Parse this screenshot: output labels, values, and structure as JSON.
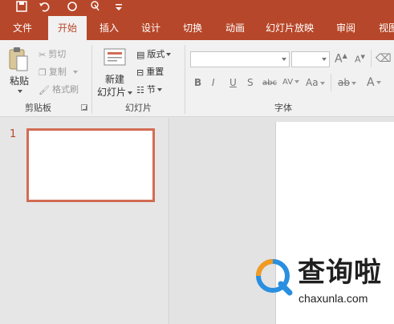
{
  "quick_access": {
    "icons": [
      "save-icon",
      "undo-icon",
      "redo-icon",
      "touch-mode-icon",
      "customize-icon"
    ]
  },
  "tabs": [
    {
      "label": "文件",
      "active": false
    },
    {
      "label": "开始",
      "active": true
    },
    {
      "label": "插入",
      "active": false
    },
    {
      "label": "设计",
      "active": false
    },
    {
      "label": "切换",
      "active": false
    },
    {
      "label": "动画",
      "active": false
    },
    {
      "label": "幻灯片放映",
      "active": false
    },
    {
      "label": "审阅",
      "active": false
    },
    {
      "label": "视图",
      "active": false
    }
  ],
  "ribbon": {
    "clipboard": {
      "paste": "粘贴",
      "cut": "剪切",
      "copy": "复制",
      "format_painter": "格式刷",
      "label": "剪贴板"
    },
    "slides": {
      "new_slide_line1": "新建",
      "new_slide_line2": "幻灯片",
      "layout": "版式",
      "reset": "重置",
      "section": "节",
      "label": "幻灯片"
    },
    "font": {
      "font_name": "",
      "font_size": "",
      "grow": "A",
      "shrink": "A",
      "bold": "B",
      "italic": "I",
      "underline": "U",
      "shadow": "S",
      "strikethrough": "abc",
      "spacing": "AV",
      "case": "Aa",
      "highlight": "ab",
      "color": "A",
      "label": "字体"
    }
  },
  "thumbnails": [
    {
      "number": "1",
      "selected": true
    }
  ],
  "watermark": {
    "brand": "查询啦",
    "domain": "chaxunla.com"
  },
  "colors": {
    "accent": "#b7472a",
    "thumb_border": "#d26c54",
    "logo_blue": "#2a8fe0",
    "logo_orange": "#f39a1e"
  }
}
